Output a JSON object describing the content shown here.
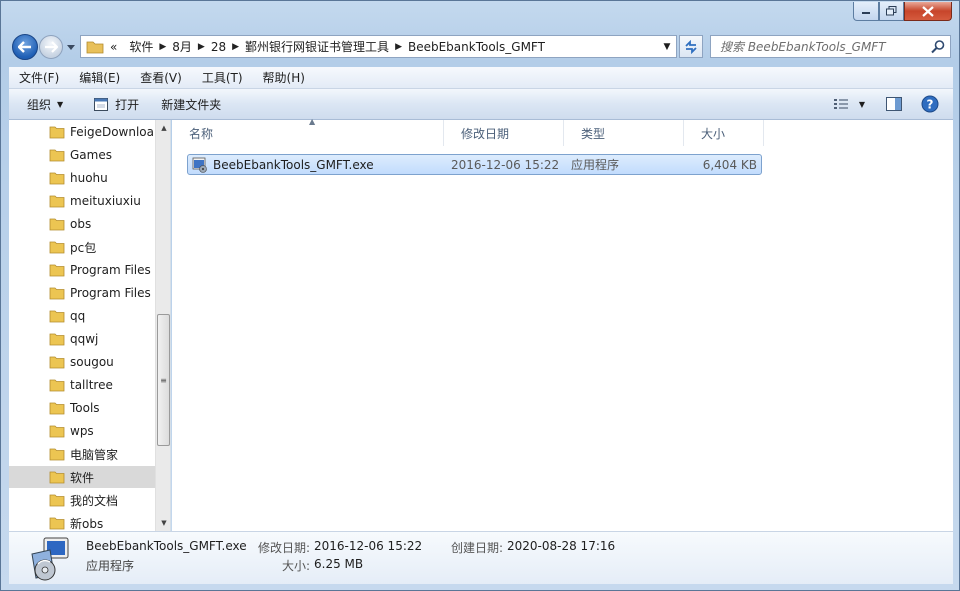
{
  "window": {
    "controls": {
      "minimize": "minimize-icon",
      "maximize": "maximize-icon",
      "close": "close-icon"
    }
  },
  "nav": {
    "breadcrumbs": [
      {
        "label": "«"
      },
      {
        "label": "软件"
      },
      {
        "label": "8月"
      },
      {
        "label": "28"
      },
      {
        "label": "鄞州银行网银证书管理工具"
      },
      {
        "label": "BeebEbankTools_GMFT"
      }
    ],
    "search_placeholder": "搜索 BeebEbankTools_GMFT"
  },
  "menubar": {
    "file": "文件(F)",
    "edit": "编辑(E)",
    "view": "查看(V)",
    "tools": "工具(T)",
    "help": "帮助(H)"
  },
  "toolbar": {
    "organize": "组织",
    "open": "打开",
    "new_folder": "新建文件夹"
  },
  "sidebar": {
    "items": [
      {
        "label": "FeigeDownloa"
      },
      {
        "label": "Games"
      },
      {
        "label": "huohu"
      },
      {
        "label": "meituxiuxiu"
      },
      {
        "label": "obs"
      },
      {
        "label": "pc包"
      },
      {
        "label": "Program Files"
      },
      {
        "label": "Program Files"
      },
      {
        "label": "qq"
      },
      {
        "label": "qqwj"
      },
      {
        "label": "sougou"
      },
      {
        "label": "talltree"
      },
      {
        "label": "Tools"
      },
      {
        "label": "wps"
      },
      {
        "label": "电脑管家"
      },
      {
        "label": "软件",
        "selected": true
      },
      {
        "label": "我的文档"
      },
      {
        "label": "新obs"
      }
    ]
  },
  "columns": {
    "name": "名称",
    "modified": "修改日期",
    "type": "类型",
    "size": "大小"
  },
  "files": [
    {
      "name": "BeebEbankTools_GMFT.exe",
      "modified": "2016-12-06 15:22",
      "type": "应用程序",
      "size": "6,404 KB"
    }
  ],
  "details": {
    "name": "BeebEbankTools_GMFT.exe",
    "type": "应用程序",
    "modified_label": "修改日期:",
    "modified_value": "2016-12-06 15:22",
    "created_label": "创建日期:",
    "created_value": "2020-08-28 17:16",
    "size_label": "大小:",
    "size_value": "6.25 MB"
  },
  "colors": {
    "frame": "#b9d1ea",
    "selection": "#c2dcfd",
    "close": "#c7452b"
  }
}
